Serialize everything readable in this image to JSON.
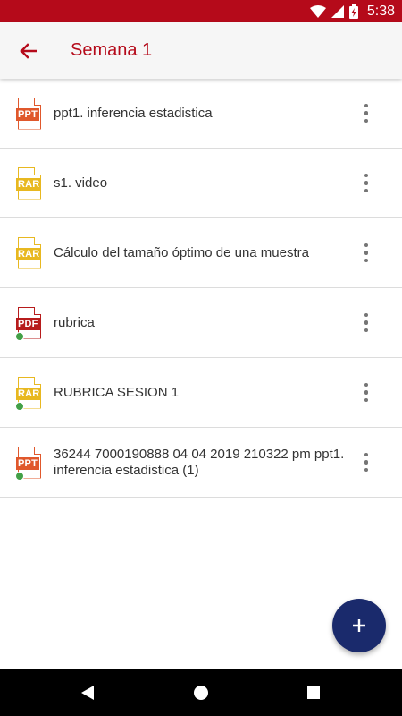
{
  "status_bar": {
    "time": "5:38",
    "icons": [
      "wifi-icon",
      "signal-icon",
      "battery-charging-icon"
    ]
  },
  "app_bar": {
    "back_icon": "arrow-back-icon",
    "title": "Semana 1"
  },
  "files": [
    {
      "type_label": "PPT",
      "name": "ppt1. inferencia estadistica",
      "color": "#e0582c",
      "status_dot": false
    },
    {
      "type_label": "RAR",
      "name": "s1. video",
      "color": "#e8b820",
      "status_dot": false
    },
    {
      "type_label": "RAR",
      "name": "Cálculo del tamaño óptimo de una muestra",
      "color": "#e8b820",
      "status_dot": false
    },
    {
      "type_label": "PDF",
      "name": "rubrica",
      "color": "#b71c1c",
      "status_dot": true
    },
    {
      "type_label": "RAR",
      "name": "RUBRICA SESION 1",
      "color": "#e8b820",
      "status_dot": true
    },
    {
      "type_label": "PPT",
      "name": "36244 7000190888 04 04 2019 210322 pm ppt1. inferencia estadistica (1)",
      "color": "#e0582c",
      "status_dot": true
    }
  ],
  "fab": {
    "icon": "plus-icon",
    "color": "#1a2a6c"
  },
  "nav": {
    "icons": [
      "back-triangle-icon",
      "home-circle-icon",
      "recents-square-icon"
    ]
  },
  "colors": {
    "accent": "#b50a1a",
    "status_dot": "#43a047"
  }
}
